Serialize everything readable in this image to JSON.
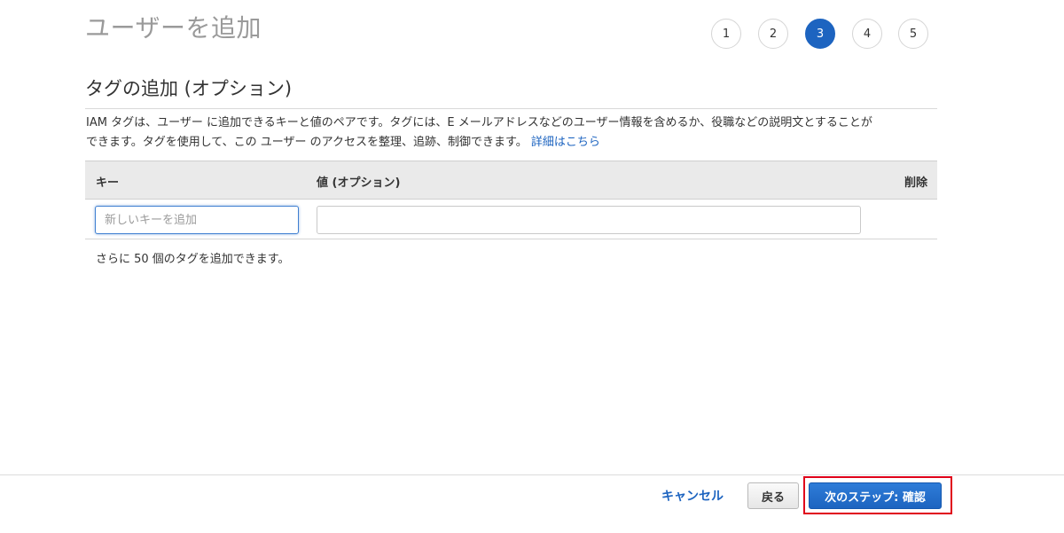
{
  "header": {
    "title": "ユーザーを追加",
    "steps": [
      {
        "label": "1",
        "active": false
      },
      {
        "label": "2",
        "active": false
      },
      {
        "label": "3",
        "active": true
      },
      {
        "label": "4",
        "active": false
      },
      {
        "label": "5",
        "active": false
      }
    ]
  },
  "section": {
    "title": "タグの追加 (オプション)",
    "description_line1": "IAM タグは、ユーザー に追加できるキーと値のペアです。タグには、E メールアドレスなどのユーザー情報を含めるか、役職などの説明文とすることが",
    "description_line2": "できます。タグを使用して、この ユーザー のアクセスを整理、追跡、制御できます。",
    "learn_more_link": "詳細はこちら"
  },
  "table": {
    "headers": {
      "key": "キー",
      "value": "値 (オプション)",
      "delete": "削除"
    },
    "row": {
      "key_placeholder": "新しいキーを追加",
      "key_value": "",
      "value_value": ""
    },
    "remaining_text": "さらに 50 個のタグを追加できます。"
  },
  "footer": {
    "cancel_label": "キャンセル",
    "back_label": "戻る",
    "next_label": "次のステップ: 確認",
    "highlight_color": "#e0001a"
  },
  "colors": {
    "accent": "#1d64c0",
    "title_gray": "#9a9a9a"
  }
}
